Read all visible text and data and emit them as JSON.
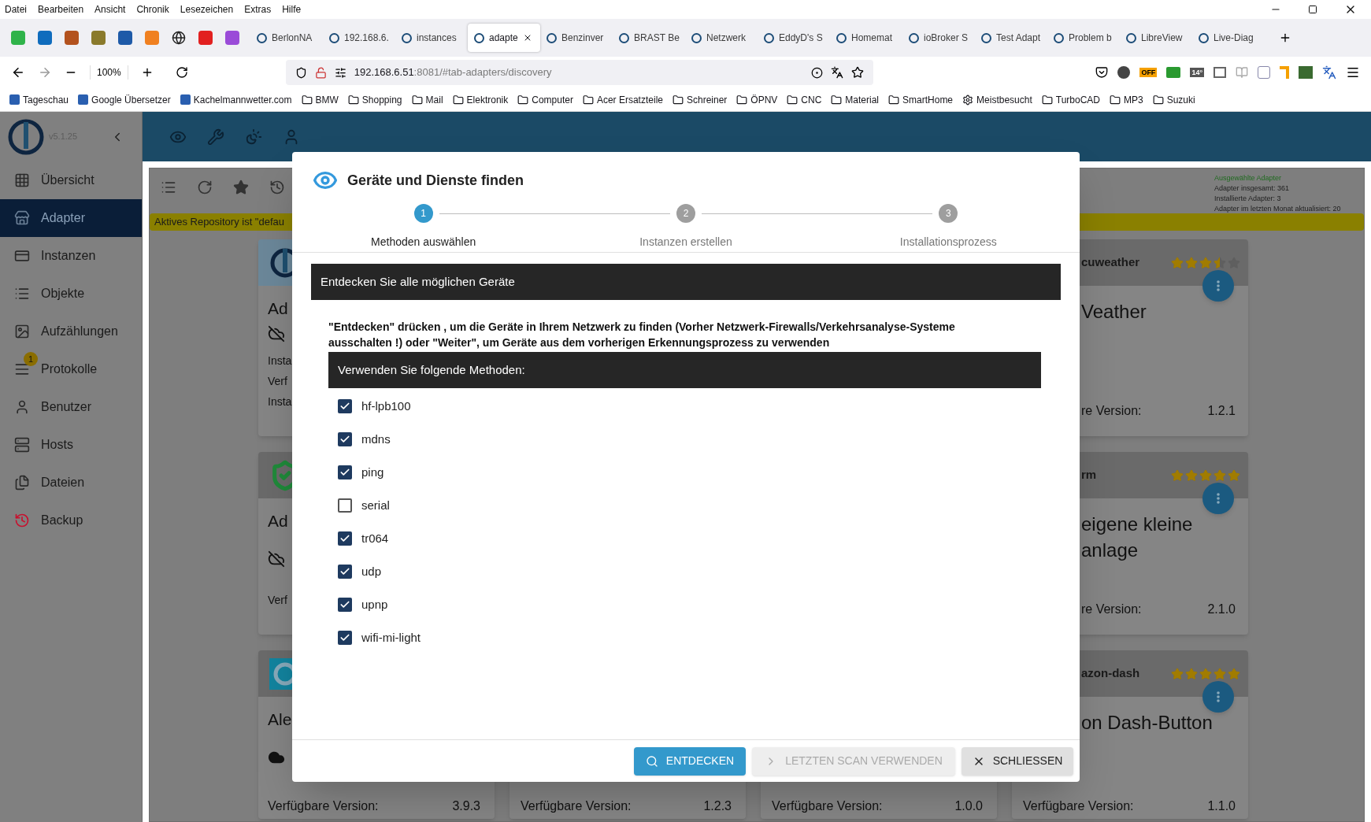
{
  "menu_bar": [
    "Datei",
    "Bearbeiten",
    "Ansicht",
    "Chronik",
    "Lesezeichen",
    "Extras",
    "Hilfe"
  ],
  "tabs": [
    {
      "label": "BerlonNA",
      "selected": false
    },
    {
      "label": "192.168.6.",
      "selected": false
    },
    {
      "label": "instances",
      "selected": false
    },
    {
      "label": "adapte",
      "selected": true
    },
    {
      "label": "Benzinver",
      "selected": false
    },
    {
      "label": "BRAST Be",
      "selected": false
    },
    {
      "label": "Netzwerk",
      "selected": false
    },
    {
      "label": "EddyD's S",
      "selected": false
    },
    {
      "label": "Homemat",
      "selected": false
    },
    {
      "label": "ioBroker S",
      "selected": false
    },
    {
      "label": "Test Adapt",
      "selected": false
    },
    {
      "label": "Problem b",
      "selected": false
    },
    {
      "label": "LibreView",
      "selected": false
    },
    {
      "label": "Live-Diag",
      "selected": false
    }
  ],
  "nav_bar": {
    "zoom": "100%",
    "url_host": "192.168.6.51",
    "url_rest": ":8081/#tab-adapters/discovery",
    "extension_badges": [
      "OFF",
      "14°"
    ]
  },
  "bookmarks": [
    {
      "label": "Tageschau",
      "kind": "site"
    },
    {
      "label": "Google Übersetzer",
      "kind": "site"
    },
    {
      "label": "Kachelmannwetter.com",
      "kind": "site"
    },
    {
      "label": "BMW",
      "kind": "folder"
    },
    {
      "label": "Shopping",
      "kind": "folder"
    },
    {
      "label": "Mail",
      "kind": "folder"
    },
    {
      "label": "Elektronik",
      "kind": "folder"
    },
    {
      "label": "Computer",
      "kind": "folder"
    },
    {
      "label": "Acer Ersatzteile",
      "kind": "folder"
    },
    {
      "label": "Schreiner",
      "kind": "folder"
    },
    {
      "label": "ÖPNV",
      "kind": "folder"
    },
    {
      "label": "CNC",
      "kind": "folder"
    },
    {
      "label": "Material",
      "kind": "folder"
    },
    {
      "label": "SmartHome",
      "kind": "folder"
    },
    {
      "label": "Meistbesucht",
      "kind": "smart"
    },
    {
      "label": "TurboCAD",
      "kind": "folder"
    },
    {
      "label": "MP3",
      "kind": "folder"
    },
    {
      "label": "Suzuki",
      "kind": "folder"
    }
  ],
  "sidebar": {
    "version": "v5.1.25",
    "items": [
      {
        "label": "Übersicht",
        "selected": false
      },
      {
        "label": "Adapter",
        "selected": true
      },
      {
        "label": "Instanzen",
        "selected": false
      },
      {
        "label": "Objekte",
        "selected": false
      },
      {
        "label": "Aufzählungen",
        "selected": false
      },
      {
        "label": "Protokolle",
        "selected": false,
        "badge": "1"
      },
      {
        "label": "Benutzer",
        "selected": false
      },
      {
        "label": "Hosts",
        "selected": false
      },
      {
        "label": "Dateien",
        "selected": false
      },
      {
        "label": "Backup",
        "selected": false
      }
    ]
  },
  "adapters": {
    "repository_banner": "Aktives Repository ist \"defau",
    "stats": {
      "title": "Ausgewählte Adapter",
      "lines": [
        "Adapter insgesamt: 361",
        "Installierte Adapter: 3",
        "Adapter im letzten Monat aktualisiert: 20"
      ]
    },
    "left_cards": [
      {
        "title": "Ad",
        "lines": [
          "Insta",
          "Verf",
          "Insta"
        ]
      },
      {
        "title": "Ad",
        "lines": [
          "Verf"
        ]
      },
      {
        "title": "Ale",
        "footer_label": "Verfügbare Version:",
        "footer_value": "3.9.3"
      }
    ],
    "middle_footers": [
      {
        "label": "Verfügbare Version:",
        "value": "1.2.3"
      },
      {
        "label": "Verfügbare Version:",
        "value": "1.0.0"
      }
    ],
    "right_cards": [
      {
        "name": "cuweather",
        "stars": 3.5,
        "title_lines": [
          "Veather"
        ],
        "footer_label": "re Version:",
        "footer_value": "1.2.1"
      },
      {
        "name": "rm",
        "stars": 5,
        "title_lines": [
          "eigene kleine",
          "anlage"
        ],
        "footer_label": "re Version:",
        "footer_value": "2.1.0"
      },
      {
        "name": "azon-dash",
        "stars": 5,
        "title_lines": [
          "on Dash-Button"
        ],
        "footer_label": "Verfügbare Version:",
        "footer_value": "1.1.0"
      }
    ]
  },
  "dialog": {
    "title": "Geräte und Dienste finden",
    "steps": [
      {
        "number": "1",
        "label": "Methoden auswählen",
        "selected": true
      },
      {
        "number": "2",
        "label": "Instanzen erstellen",
        "selected": false
      },
      {
        "number": "3",
        "label": "Installationsprozess",
        "selected": false
      }
    ],
    "section_title": "Entdecken Sie alle möglichen Geräte",
    "instructions": "\"Entdecken\" drücken , um die Geräte in Ihrem Netzwerk zu finden (Vorher Netzwerk-Firewalls/Verkehrsanalyse-Systeme ausschalten !) oder \"Weiter\", um Geräte aus dem vorherigen Erkennungsprozess zu verwenden",
    "methods_title": "Verwenden Sie folgende Methoden:",
    "methods": [
      {
        "label": "hf-lpb100",
        "checked": true
      },
      {
        "label": "mdns",
        "checked": true
      },
      {
        "label": "ping",
        "checked": true
      },
      {
        "label": "serial",
        "checked": false
      },
      {
        "label": "tr064",
        "checked": true
      },
      {
        "label": "udp",
        "checked": true
      },
      {
        "label": "upnp",
        "checked": true
      },
      {
        "label": "wifi-mi-light",
        "checked": true
      }
    ],
    "buttons": [
      {
        "label": "ENTDECKEN",
        "kind": "primary",
        "disabled": false
      },
      {
        "label": "LETZTEN SCAN VERWENDEN",
        "kind": "next",
        "disabled": true
      },
      {
        "label": "SCHLIESSEN",
        "kind": "close",
        "disabled": false
      }
    ]
  }
}
